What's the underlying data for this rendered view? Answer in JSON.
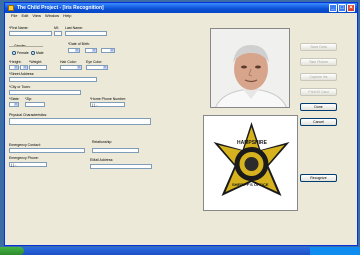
{
  "window": {
    "title": "The Child Project - [Iris Recognition]"
  },
  "menu": [
    "File",
    "Edit",
    "View",
    "Window",
    "Help"
  ],
  "form": {
    "first_name": "*First Name:",
    "mi": "MI:",
    "last_name": "Last Name:",
    "gender": "Gender",
    "female": "Female",
    "male": "Male",
    "dob": "*Date of Birth:",
    "height": "*Height:",
    "weight": "*Weight:",
    "hair_color": "Hair Color:",
    "eye_color": "Eye Color:",
    "street": "*Street Address:",
    "city": "*City or Town:",
    "state": "*State:",
    "zip": "*Zip:",
    "home_phone": "*Home Phone Number:",
    "home_phone_value": "(  )    -",
    "physical": "Physical Characteristics:",
    "emergency_contact": "Emergency Contact:",
    "relationship": "Relationship:",
    "emergency_phone": "Emergency Phone:",
    "emergency_phone_value": "(  )    -",
    "email": "EMail Address:"
  },
  "buttons": {
    "save": "Save Data",
    "take_picture": "Take Picture",
    "capture_iris": "Capture Iris",
    "print_id": "Print ID Card",
    "done": "Done",
    "cancel": "Cancel",
    "recognize": "Recognize"
  },
  "badge": {
    "top": "HAMPSHIRE",
    "bottom": "SHERIFF'S OFFICE"
  },
  "colors": {
    "titlebar": "#0a4fd6",
    "desktop": "#3a6ea5",
    "badge_gold": "#d6b21e"
  }
}
